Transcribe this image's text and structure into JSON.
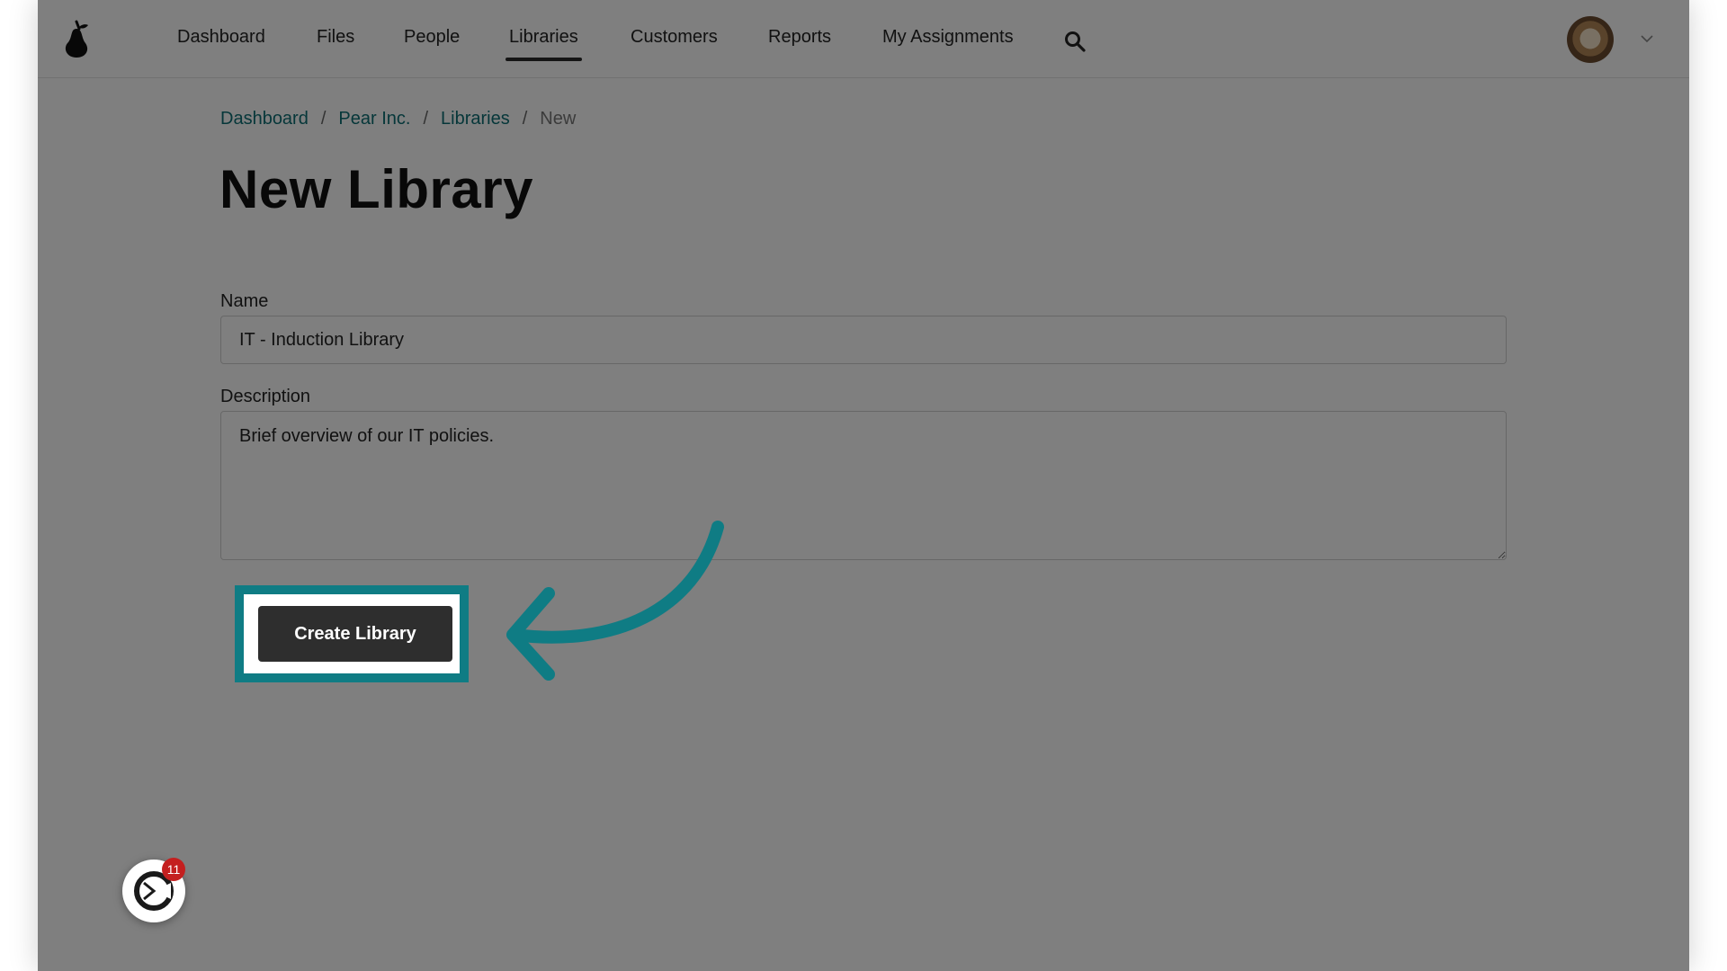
{
  "nav": {
    "items": [
      {
        "label": "Dashboard"
      },
      {
        "label": "Files"
      },
      {
        "label": "People"
      },
      {
        "label": "Libraries",
        "active": true
      },
      {
        "label": "Customers"
      },
      {
        "label": "Reports"
      },
      {
        "label": "My Assignments"
      }
    ],
    "logo_icon": "pear-logo-icon",
    "search_icon": "search-icon",
    "account_icon": "chevron-down-icon"
  },
  "breadcrumb": {
    "items": [
      "Dashboard",
      "Pear Inc.",
      "Libraries"
    ],
    "separator": "/",
    "current": "New"
  },
  "page": {
    "title": "New Library"
  },
  "form": {
    "name_label": "Name",
    "name_value": "IT - Induction Library",
    "description_label": "Description",
    "description_value": "Brief overview of our IT policies.",
    "submit_label": "Create Library"
  },
  "annotation": {
    "highlight_color": "#0f7c84",
    "overlay_color": "#000000",
    "overlay_opacity": 0.5
  },
  "widget": {
    "icon": "chat-widget-icon",
    "badge_count": "11"
  }
}
